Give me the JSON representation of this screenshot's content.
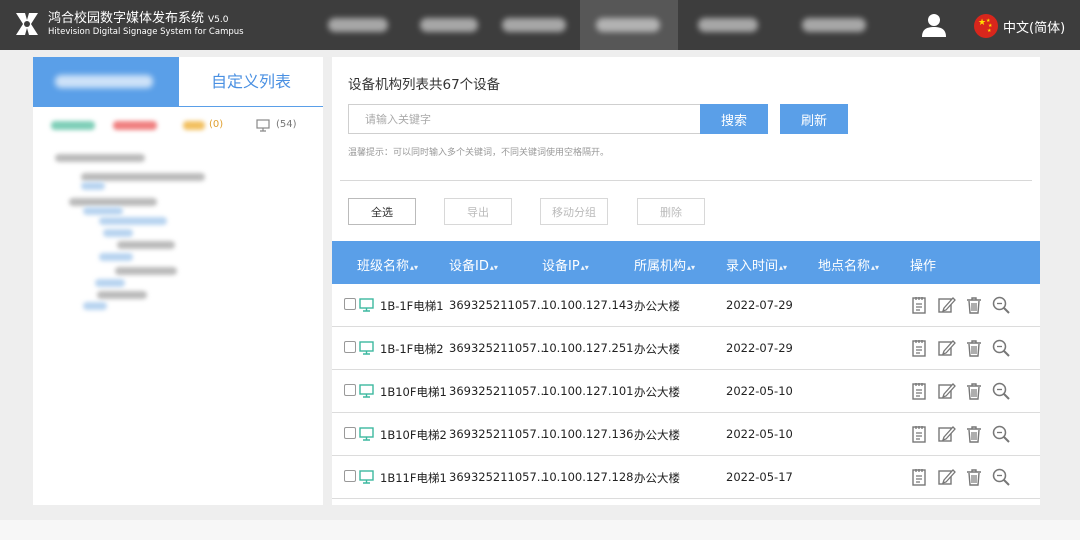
{
  "header": {
    "title": "鸿合校园数字媒体发布系统",
    "version": "V5.0",
    "subtitle": "Hitevision Digital Signage System for Campus",
    "language": "中文(简体)"
  },
  "left_panel": {
    "tab_custom_label": "自定义列表",
    "stat_yellow": "(0)",
    "stat_total": "(54)"
  },
  "main": {
    "title": "设备机构列表共67个设备",
    "search_placeholder": "请输入关键字",
    "search_button": "搜索",
    "refresh_button": "刷新",
    "tip": "温馨提示：可以同时输入多个关键词，不同关键词使用空格隔开。",
    "actions": [
      "全选",
      "导出",
      "移动分组",
      "删除"
    ],
    "columns": [
      "班级名称",
      "设备ID",
      "设备IP",
      "所属机构",
      "录入时间",
      "地点名称",
      "操作"
    ],
    "rows": [
      {
        "name": "1B-1F电梯1",
        "id": "369325211057...",
        "ip": "10.100.127.143",
        "org": "办公大楼",
        "time": "2022-07-29",
        "place": ""
      },
      {
        "name": "1B-1F电梯2",
        "id": "369325211057...",
        "ip": "10.100.127.251",
        "org": "办公大楼",
        "time": "2022-07-29",
        "place": ""
      },
      {
        "name": "1B10F电梯1",
        "id": "369325211057...",
        "ip": "10.100.127.101",
        "org": "办公大楼",
        "time": "2022-05-10",
        "place": ""
      },
      {
        "name": "1B10F电梯2",
        "id": "369325211057...",
        "ip": "10.100.127.136",
        "org": "办公大楼",
        "time": "2022-05-10",
        "place": ""
      },
      {
        "name": "1B11F电梯1",
        "id": "369325211057...",
        "ip": "10.100.127.128",
        "org": "办公大楼",
        "time": "2022-05-17",
        "place": ""
      }
    ]
  },
  "colors": {
    "header_bg": "#3d3d3d",
    "accent": "#5a9fe8",
    "device_icon": "#3db8a0"
  },
  "icons": [
    "logo-icon",
    "user-icon",
    "china-flag-icon",
    "monitor-icon",
    "details-icon",
    "edit-icon",
    "delete-icon",
    "search-zoom-icon"
  ]
}
